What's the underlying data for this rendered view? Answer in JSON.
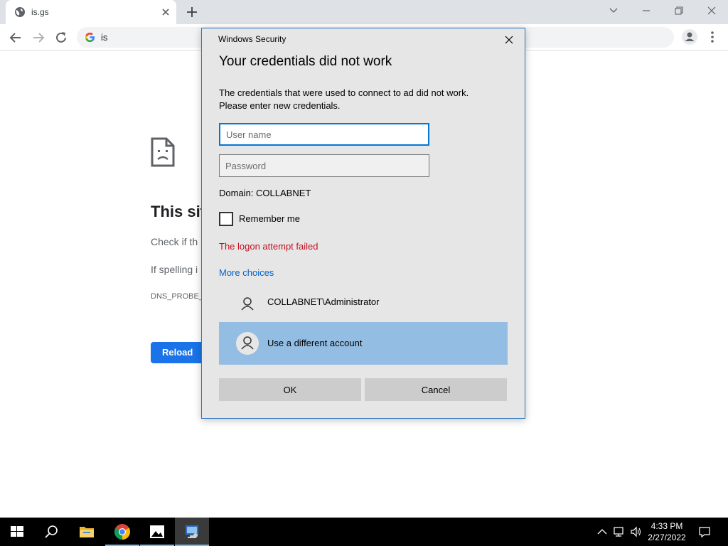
{
  "browser": {
    "tab_title": "is.gs",
    "address_text": "is"
  },
  "page": {
    "heading": "This sit",
    "line1": "Check if th",
    "line2": "If spelling i",
    "error_code": "DNS_PROBE_",
    "reload_label": "Reload"
  },
  "dialog": {
    "caption": "Windows Security",
    "title": "Your credentials did not work",
    "message_line1": "The credentials that were used to connect to ad did not work.",
    "message_line2": "Please enter new credentials.",
    "username_placeholder": "User name",
    "password_placeholder": "Password",
    "domain": "Domain: COLLABNET",
    "remember_label": "Remember me",
    "error_text": "The logon attempt failed",
    "more_choices": "More choices",
    "accounts": [
      {
        "label": "COLLABNET\\Administrator"
      },
      {
        "label": "Use a different account"
      }
    ],
    "ok_label": "OK",
    "cancel_label": "Cancel"
  },
  "taskbar": {
    "time": "4:33 PM",
    "date": "2/27/2022"
  },
  "colors": {
    "dialog_border": "#2b79c2",
    "selected_account": "#93bde3",
    "error_red": "#c50f1f",
    "link_blue": "#0066cc",
    "reload_blue": "#1a73e8"
  }
}
